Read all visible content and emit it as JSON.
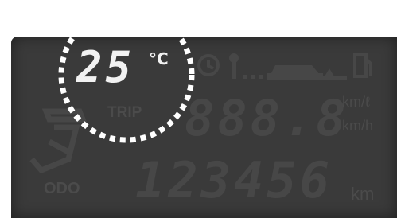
{
  "display": {
    "temperature": "25",
    "temperature_unit": "°C",
    "trip_label": "TRIP",
    "trip_value": "888.8",
    "unit_top": "km/ℓ",
    "unit_bottom": "km/h",
    "odo_label": "ODO",
    "odo_value": "123456",
    "odo_unit": "km"
  },
  "colors": {
    "panel": "#3a3a3a",
    "active_segment": "#f2f2f2",
    "inactive_segment": "#4b4b4b",
    "highlight_ring": "#ffffff"
  },
  "icons": [
    "clock-icon",
    "key-icon",
    "car-icon",
    "dashed-line-icon",
    "fuel-icon",
    "road-warning-icon"
  ]
}
